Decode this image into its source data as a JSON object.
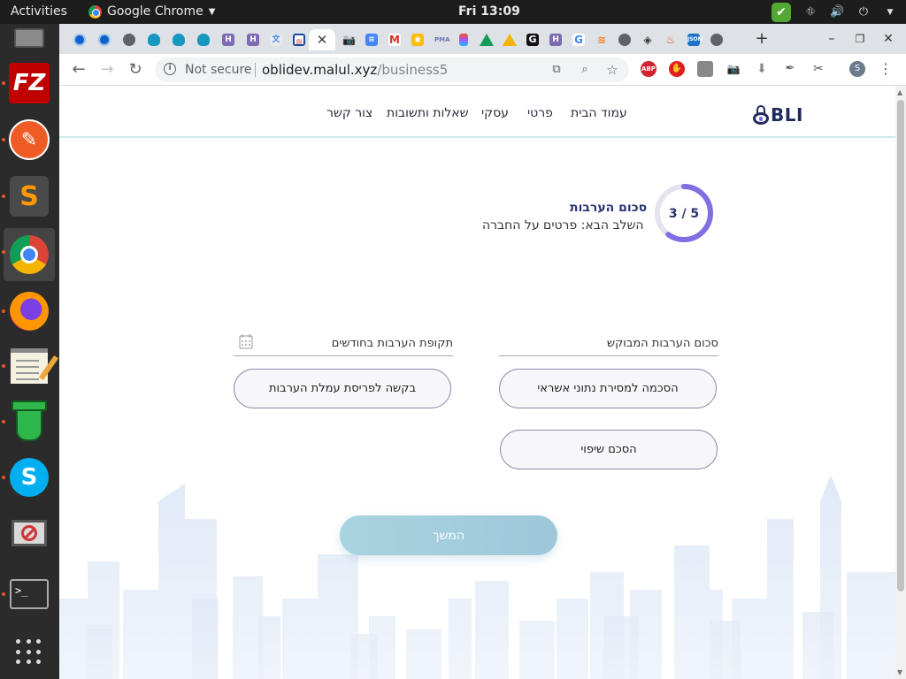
{
  "desktop": {
    "activities": "Activities",
    "app_menu": "Google Chrome",
    "clock": "Fri 13:09"
  },
  "browser": {
    "tab_favicons": [
      "globe-blue",
      "globe-blue",
      "globe",
      "salesforce",
      "salesforce",
      "salesforce",
      "hebrew-h",
      "hebrew-h",
      "translate",
      "id-card",
      "active-close",
      "camera",
      "docs",
      "gmail",
      "keep",
      "pma",
      "figma",
      "drive",
      "drive",
      "G",
      "hebrew-h",
      "google",
      "stackoverflow",
      "globe",
      "diamond",
      "fire",
      "json",
      "globe"
    ],
    "omnibox": {
      "security": "Not secure",
      "host": "oblidev.malul.xyz",
      "path": "/business5"
    },
    "profile_initial": "S",
    "abp_label": "ABP"
  },
  "site": {
    "logo_text": "BLI",
    "nav": [
      "עמוד הבית",
      "פרטי",
      "עסקי",
      "שאלות ותשובות",
      "צור קשר"
    ],
    "stepper": {
      "label": "3 / 5",
      "progress": 0.6
    },
    "step_title": "סכום הערבות",
    "step_next": "השלב הבא: פרטים על החברה",
    "fields": {
      "requested_amount": "סכום הערבות המבוקש",
      "period_months": "תקופת הערבות בחודשים"
    },
    "buttons": {
      "credit_consent": "הסכמה למסירת נתוני אשראי",
      "fee_spread": "בקשה לפריסת עמלת הערבות",
      "indemnity": "הסכם שיפוי",
      "continue": "המשך"
    }
  }
}
